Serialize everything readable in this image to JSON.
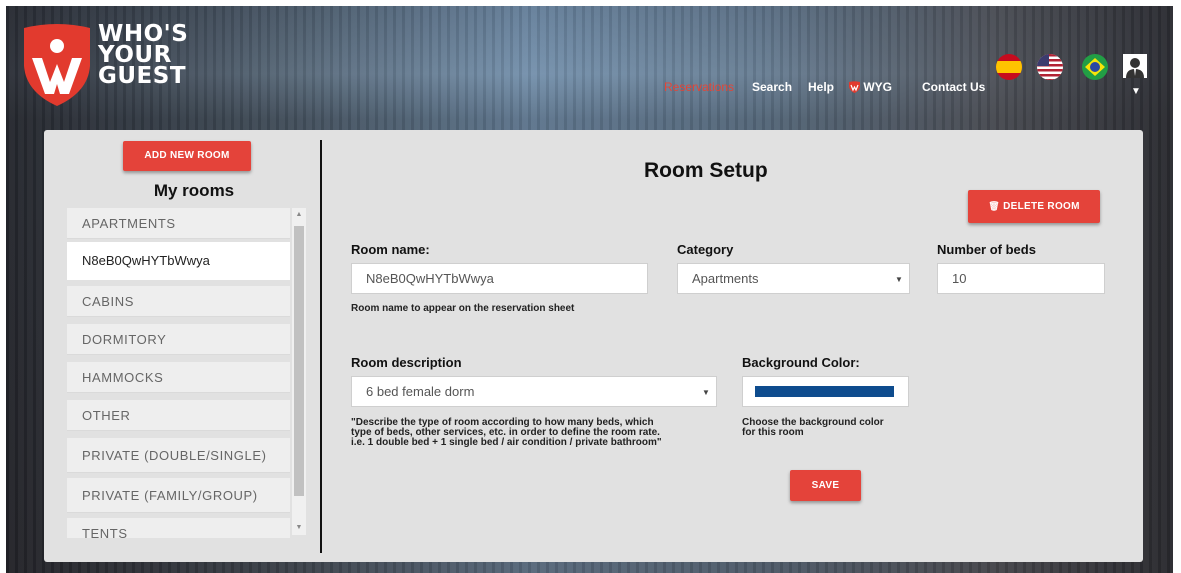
{
  "app": {
    "logo_lines": [
      "WHO'S",
      "YOUR",
      "GUEST"
    ]
  },
  "nav": {
    "reservations": "Reservations",
    "search": "Search",
    "help": "Help",
    "wyg": "WYG",
    "contact": "Contact Us"
  },
  "flags": [
    "spain-flag-icon",
    "usa-flag-icon",
    "brazil-flag-icon"
  ],
  "sidebar": {
    "add_button": "ADD NEW ROOM",
    "title": "My rooms",
    "categories": [
      "APARTMENTS",
      "CABINS",
      "DORMITORY",
      "HAMMOCKS",
      "OTHER",
      "PRIVATE (DOUBLE/SINGLE)",
      "PRIVATE (FAMILY/GROUP)",
      "TENTS"
    ],
    "selected_room": "N8eB0QwHYTbWwya"
  },
  "form": {
    "title": "Room Setup",
    "delete_button": "DELETE ROOM",
    "room_name_label": "Room name:",
    "room_name_value": "N8eB0QwHYTbWwya",
    "room_name_hint": "Room name to appear on the reservation sheet",
    "category_label": "Category",
    "category_value": "Apartments",
    "beds_label": "Number of beds",
    "beds_value": "10",
    "description_label": "Room description",
    "description_value": "6 bed female dorm",
    "description_hint_1": "\"Describe the type of room according to how many beds, which",
    "description_hint_2": "type of beds, other services, etc. in order to define the room rate.",
    "description_hint_3": "i.e. 1 double bed + 1 single bed / air condition / private bathroom\"",
    "bgcolor_label": "Background Color:",
    "bgcolor_value": "#0e4c8e",
    "bgcolor_hint_1": "Choose the background color",
    "bgcolor_hint_2": "for this room",
    "save_button": "SAVE"
  },
  "colors": {
    "accent": "#e4433a",
    "panel": "#e1e1e1"
  }
}
